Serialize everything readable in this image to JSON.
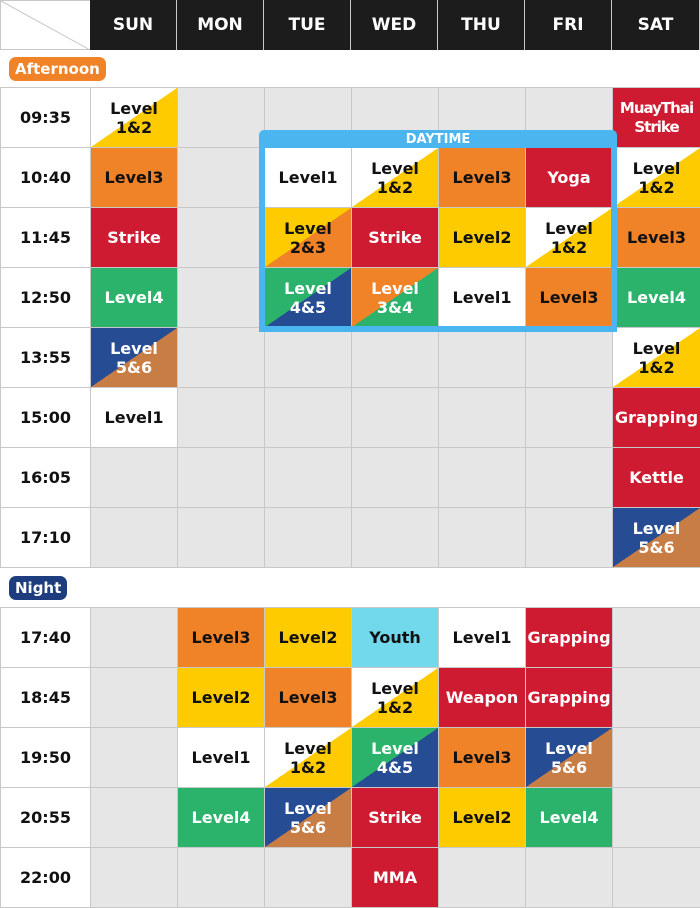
{
  "colors": {
    "white": "#ffffff",
    "yellow": "#fecb00",
    "orange": "#f08228",
    "red": "#cf1b32",
    "green": "#2bb36c",
    "blue": "#264c94",
    "brown": "#c87d45",
    "cyan": "#72d8ec",
    "empty": "#e6e6e6",
    "daytime_border": "#4ab5ee",
    "afternoon_badge": "#f08228",
    "night_badge": "#1d3d7e",
    "header_bg": "#1c1c1c"
  },
  "days": [
    "SUN",
    "MON",
    "TUE",
    "WED",
    "THU",
    "FRI",
    "SAT"
  ],
  "sections": {
    "afternoon": {
      "label": "Afternoon"
    },
    "night": {
      "label": "Night"
    },
    "daytime": {
      "label": "DAYTIME"
    }
  },
  "afternoon_rows": [
    {
      "time": "09:35",
      "cells": [
        {
          "l1": "Level",
          "l2": "1&2",
          "bg": "white",
          "tri": "yellow",
          "fg": "#111"
        },
        null,
        null,
        null,
        null,
        null,
        {
          "l1": "MuayThai",
          "l2": "Strike",
          "bg": "red",
          "fg": "#fff",
          "small": true
        }
      ]
    },
    {
      "time": "10:40",
      "cells": [
        {
          "l1": "Level3",
          "bg": "orange",
          "fg": "#111"
        },
        null,
        {
          "l1": "Level1",
          "bg": "white",
          "fg": "#111"
        },
        {
          "l1": "Level",
          "l2": "1&2",
          "bg": "white",
          "tri": "yellow",
          "fg": "#111"
        },
        {
          "l1": "Level3",
          "bg": "orange",
          "fg": "#111"
        },
        {
          "l1": "Yoga",
          "bg": "red",
          "fg": "#fff"
        },
        {
          "l1": "Level",
          "l2": "1&2",
          "bg": "white",
          "tri": "yellow",
          "fg": "#111"
        }
      ]
    },
    {
      "time": "11:45",
      "cells": [
        {
          "l1": "Strike",
          "bg": "red",
          "fg": "#fff"
        },
        null,
        {
          "l1": "Level",
          "l2": "2&3",
          "bg": "yellow",
          "tri": "orange",
          "fg": "#111"
        },
        {
          "l1": "Strike",
          "bg": "red",
          "fg": "#fff"
        },
        {
          "l1": "Level2",
          "bg": "yellow",
          "fg": "#111"
        },
        {
          "l1": "Level",
          "l2": "1&2",
          "bg": "white",
          "tri": "yellow",
          "fg": "#111"
        },
        {
          "l1": "Level3",
          "bg": "orange",
          "fg": "#111"
        }
      ]
    },
    {
      "time": "12:50",
      "cells": [
        {
          "l1": "Level4",
          "bg": "green",
          "fg": "#fff"
        },
        null,
        {
          "l1": "Level",
          "l2": "4&5",
          "bg": "green",
          "tri": "blue",
          "fg": "#fff"
        },
        {
          "l1": "Level",
          "l2": "3&4",
          "bg": "orange",
          "tri": "green",
          "fg": "#fff"
        },
        {
          "l1": "Level1",
          "bg": "white",
          "fg": "#111"
        },
        {
          "l1": "Level3",
          "bg": "orange",
          "fg": "#111"
        },
        {
          "l1": "Level4",
          "bg": "green",
          "fg": "#fff"
        }
      ]
    },
    {
      "time": "13:55",
      "cells": [
        {
          "l1": "Level",
          "l2": "5&6",
          "bg": "blue",
          "tri": "brown",
          "fg": "#fff"
        },
        null,
        null,
        null,
        null,
        null,
        {
          "l1": "Level",
          "l2": "1&2",
          "bg": "white",
          "tri": "yellow",
          "fg": "#111"
        }
      ]
    },
    {
      "time": "15:00",
      "cells": [
        {
          "l1": "Level1",
          "bg": "white",
          "fg": "#111"
        },
        null,
        null,
        null,
        null,
        null,
        {
          "l1": "Grapping",
          "bg": "red",
          "fg": "#fff"
        }
      ]
    },
    {
      "time": "16:05",
      "cells": [
        null,
        null,
        null,
        null,
        null,
        null,
        {
          "l1": "Kettle",
          "bg": "red",
          "fg": "#fff"
        }
      ]
    },
    {
      "time": "17:10",
      "cells": [
        null,
        null,
        null,
        null,
        null,
        null,
        {
          "l1": "Level",
          "l2": "5&6",
          "bg": "blue",
          "tri": "brown",
          "fg": "#fff"
        }
      ]
    }
  ],
  "night_rows": [
    {
      "time": "17:40",
      "cells": [
        null,
        {
          "l1": "Level3",
          "bg": "orange",
          "fg": "#111"
        },
        {
          "l1": "Level2",
          "bg": "yellow",
          "fg": "#111"
        },
        {
          "l1": "Youth",
          "bg": "cyan",
          "fg": "#111"
        },
        {
          "l1": "Level1",
          "bg": "white",
          "fg": "#111"
        },
        {
          "l1": "Grapping",
          "bg": "red",
          "fg": "#fff"
        },
        null
      ]
    },
    {
      "time": "18:45",
      "cells": [
        null,
        {
          "l1": "Level2",
          "bg": "yellow",
          "fg": "#111"
        },
        {
          "l1": "Level3",
          "bg": "orange",
          "fg": "#111"
        },
        {
          "l1": "Level",
          "l2": "1&2",
          "bg": "white",
          "tri": "yellow",
          "fg": "#111"
        },
        {
          "l1": "Weapon",
          "bg": "red",
          "fg": "#fff"
        },
        {
          "l1": "Grapping",
          "bg": "red",
          "fg": "#fff"
        },
        null
      ]
    },
    {
      "time": "19:50",
      "cells": [
        null,
        {
          "l1": "Level1",
          "bg": "white",
          "fg": "#111"
        },
        {
          "l1": "Level",
          "l2": "1&2",
          "bg": "white",
          "tri": "yellow",
          "fg": "#111"
        },
        {
          "l1": "Level",
          "l2": "4&5",
          "bg": "green",
          "tri": "blue",
          "fg": "#fff"
        },
        {
          "l1": "Level3",
          "bg": "orange",
          "fg": "#111"
        },
        {
          "l1": "Level",
          "l2": "5&6",
          "bg": "blue",
          "tri": "brown",
          "fg": "#fff"
        },
        null
      ]
    },
    {
      "time": "20:55",
      "cells": [
        null,
        {
          "l1": "Level4",
          "bg": "green",
          "fg": "#fff"
        },
        {
          "l1": "Level",
          "l2": "5&6",
          "bg": "blue",
          "tri": "brown",
          "fg": "#fff"
        },
        {
          "l1": "Strike",
          "bg": "red",
          "fg": "#fff"
        },
        {
          "l1": "Level2",
          "bg": "yellow",
          "fg": "#111"
        },
        {
          "l1": "Level4",
          "bg": "green",
          "fg": "#fff"
        },
        null
      ]
    },
    {
      "time": "22:00",
      "cells": [
        null,
        null,
        null,
        {
          "l1": "MMA",
          "bg": "red",
          "fg": "#fff"
        },
        null,
        null,
        null
      ]
    }
  ]
}
